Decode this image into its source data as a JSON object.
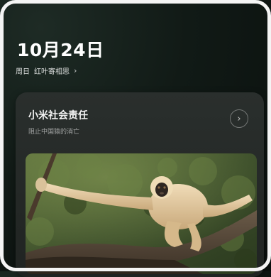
{
  "lockscreen": {
    "date": "10月24日",
    "weekday": "周日",
    "event": "红叶寄相思",
    "chevron": "›"
  },
  "card": {
    "title": "小米社会责任",
    "subtitle": "阻止中国猿的消亡",
    "action_icon": "chevron-right-icon",
    "action_glyph": "›"
  },
  "photo": {
    "subject_icon": "gibbon-photo"
  }
}
